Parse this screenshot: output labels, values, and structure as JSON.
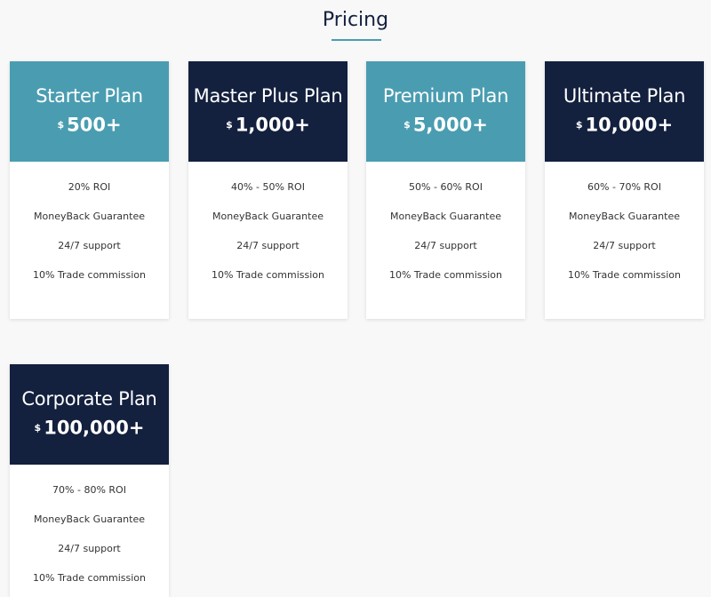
{
  "page": {
    "title": "Pricing",
    "accent_color": "#4a9db1",
    "dark_color": "#13203e"
  },
  "plans": [
    {
      "name": "Starter Plan",
      "currency": "$",
      "amount": "500+",
      "theme": "teal",
      "features": [
        "20% ROI",
        "MoneyBack Guarantee",
        "24/7 support",
        "10% Trade commission"
      ]
    },
    {
      "name": "Master Plus Plan",
      "currency": "$",
      "amount": "1,000+",
      "theme": "navy",
      "features": [
        "40% - 50% ROI",
        "MoneyBack Guarantee",
        "24/7 support",
        "10% Trade commission"
      ]
    },
    {
      "name": "Premium Plan",
      "currency": "$",
      "amount": "5,000+",
      "theme": "teal",
      "features": [
        "50% - 60% ROI",
        "MoneyBack Guarantee",
        "24/7 support",
        "10% Trade commission"
      ]
    },
    {
      "name": "Ultimate Plan",
      "currency": "$",
      "amount": "10,000+",
      "theme": "navy",
      "features": [
        "60% - 70% ROI",
        "MoneyBack Guarantee",
        "24/7 support",
        "10% Trade commission"
      ]
    },
    {
      "name": "Corporate Plan",
      "currency": "$",
      "amount": "100,000+",
      "theme": "navy",
      "features": [
        "70% - 80% ROI",
        "MoneyBack Guarantee",
        "24/7 support",
        "10% Trade commission"
      ]
    }
  ]
}
